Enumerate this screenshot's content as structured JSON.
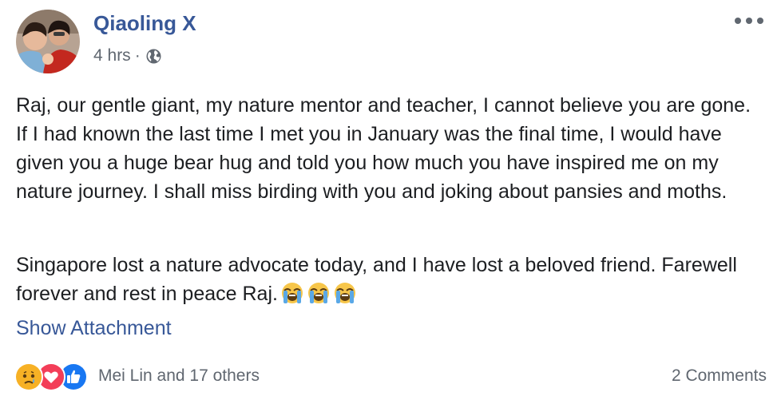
{
  "post": {
    "author": "Qiaoling X",
    "time": "4 hrs",
    "separator": "·",
    "privacy_icon": "globe-icon",
    "menu_icon": "more-icon",
    "paragraph_1": "Raj, our gentle giant, my nature mentor and teacher, I cannot believe you are gone. If I had known the last time I met you in January was the final time, I would have given you a huge bear hug and told you how much you have inspired me on my nature journey. I shall miss birding with you and joking about pansies and moths.",
    "paragraph_2": "Singapore lost a nature advocate today, and I have lost a beloved friend. Farewell forever and rest in peace Raj.",
    "emojis": [
      "loudly-crying-face-icon",
      "loudly-crying-face-icon",
      "loudly-crying-face-icon"
    ],
    "show_attachment": "Show Attachment"
  },
  "footer": {
    "reaction_icons": [
      "sad-reaction-icon",
      "love-reaction-icon",
      "like-reaction-icon"
    ],
    "reaction_names": "Mei Lin and 17 others",
    "comments": "2 Comments"
  },
  "colors": {
    "link": "#385898",
    "secondary_text": "#606770",
    "like_blue": "#1877f2",
    "love_red": "#f33e58",
    "sad_yellow": "#f7b125"
  }
}
